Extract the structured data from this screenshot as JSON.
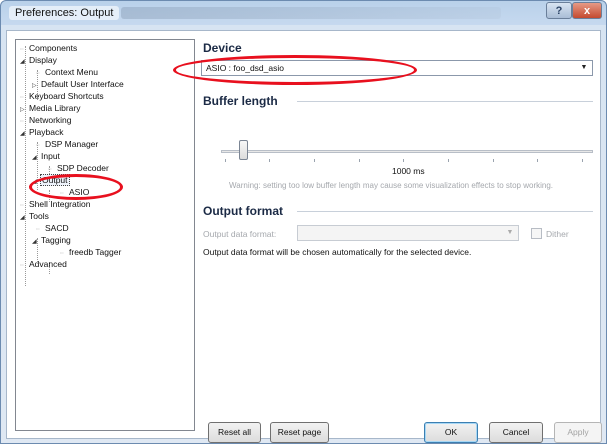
{
  "window": {
    "title": "Preferences: Output",
    "help_button": "?",
    "close_button": "x"
  },
  "tree": [
    {
      "label": "Components"
    },
    {
      "label": "Display",
      "expander": "◢"
    },
    {
      "label": "Context Menu"
    },
    {
      "label": "Default User Interface",
      "expander": "▷"
    },
    {
      "label": "Keyboard Shortcuts"
    },
    {
      "label": "Media Library",
      "expander": "▷"
    },
    {
      "label": "Networking"
    },
    {
      "label": "Playback",
      "expander": "◢"
    },
    {
      "label": "DSP Manager"
    },
    {
      "label": "Input",
      "expander": "◢"
    },
    {
      "label": "SDP Decoder"
    },
    {
      "label": "Output",
      "expander": "◢",
      "selected": true
    },
    {
      "label": "ASIO"
    },
    {
      "label": "Shell Integration"
    },
    {
      "label": "Tools",
      "expander": "◢"
    },
    {
      "label": "SACD"
    },
    {
      "label": "Tagging",
      "expander": "◢"
    },
    {
      "label": "freedb Tagger"
    },
    {
      "label": "Advanced"
    }
  ],
  "device": {
    "heading": "Device",
    "selected": "ASIO : foo_dsd_asio"
  },
  "buffer": {
    "heading": "Buffer length",
    "value": "1000 ms",
    "slider_fraction": 0.05,
    "warning": "Warning: setting too low buffer length may cause some visualization effects to stop working."
  },
  "output_format": {
    "heading": "Output format",
    "data_format_label": "Output data format:",
    "dither_label": "Dither",
    "note": "Output data format will be chosen automatically for the selected device."
  },
  "buttons": {
    "reset_all": "Reset all",
    "reset_page": "Reset page",
    "ok": "OK",
    "cancel": "Cancel",
    "apply": "Apply"
  },
  "colors": {
    "annotation": "#e8101e",
    "accent": "#3c7fb1"
  }
}
